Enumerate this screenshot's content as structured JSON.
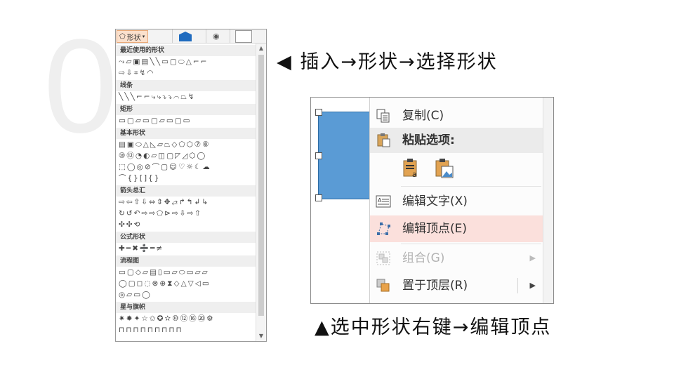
{
  "step_number": "0",
  "gallery": {
    "shape_button_label": "形状",
    "categories": [
      {
        "label": "最近使用的形状",
        "rows": [
          "⤳▱▣▤╲╲▭▢⬭△⌐⌐",
          "⇨⇩⌗↯◠"
        ]
      },
      {
        "label": "线条",
        "rows": [
          "╲╲╲⌐⌐⤷⤷⤵⤵⌒⏢↯"
        ]
      },
      {
        "label": "矩形",
        "rows": [
          "▭▢▱▭▢▱▭▢▭"
        ]
      },
      {
        "label": "基本形状",
        "rows": [
          "▤▣⬭△◺▱⏢◇⬠⬡⑦⑧",
          "⑩⑫◔◐▱◫▢◸◿⬡◯",
          "⬚◯◎⊘⌒▢☺♡☼☾☁",
          "⌒{}[]{}"
        ]
      },
      {
        "label": "箭头总汇",
        "rows": [
          "⇨⇦⇧⇩⇔⇕✥⥄↱↰↲↳",
          "↻↺↶⇨⇨⬠⊳⇨⇩⇨⇧",
          "✣✣⟲"
        ]
      },
      {
        "label": "公式形状",
        "rows": [
          "✚━✖➗═≠"
        ]
      },
      {
        "label": "流程图",
        "rows": [
          "▭▢◇▱▤▯▭▱⬭▭▱▱",
          "◯▢◻◌⊗⊕⧗◇△▽◁▭",
          "◎▱▭◯"
        ]
      },
      {
        "label": "星与旗帜",
        "rows": [
          "✷✸✦☆✩✪✫⑩⑫⑯⑳⚙",
          "⊓⊓⊓⊓⊓⊓⊓⊓⊓"
        ]
      }
    ]
  },
  "caption_top": "◀ 插入→形状→选择形状",
  "caption_bottom": "▲选中形状右键→编辑顶点",
  "context_menu": {
    "items": [
      {
        "label": "复制(C)",
        "icon": "copy-icon"
      },
      {
        "label": "粘贴选项:",
        "icon": "paste-icon"
      },
      {
        "label": "编辑文字(X)",
        "icon": "edit-text-icon"
      },
      {
        "label": "编辑顶点(E)",
        "icon": "edit-points-icon"
      },
      {
        "label": "组合(G)",
        "icon": "group-icon"
      },
      {
        "label": "置于顶层(R)",
        "icon": "bring-to-front-icon"
      }
    ]
  },
  "colors": {
    "shape_fill": "#5a9bd5",
    "highlight": "#fbe0dc",
    "shape_button": "#fbe0cc"
  }
}
